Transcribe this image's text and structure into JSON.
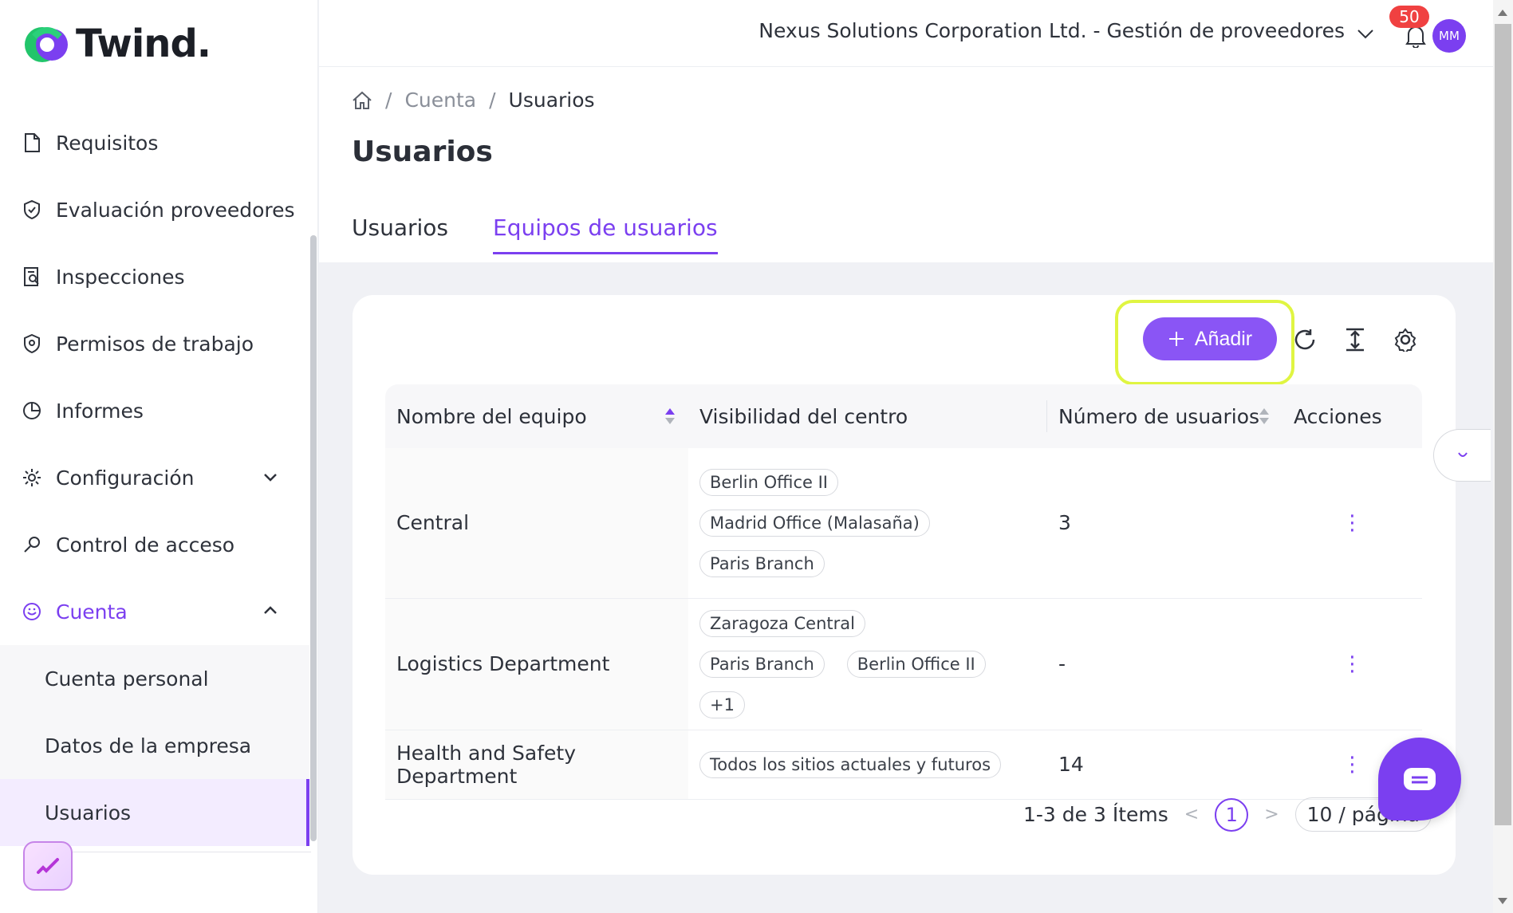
{
  "brand": {
    "name": "Twind."
  },
  "sidebar": {
    "items": [
      {
        "label": "Requisitos"
      },
      {
        "label": "Evaluación proveedores"
      },
      {
        "label": "Inspecciones"
      },
      {
        "label": "Permisos de trabajo"
      },
      {
        "label": "Informes"
      },
      {
        "label": "Configuración"
      },
      {
        "label": "Control de acceso"
      },
      {
        "label": "Cuenta"
      }
    ],
    "sub_items": [
      {
        "label": "Cuenta personal"
      },
      {
        "label": "Datos de la empresa"
      },
      {
        "label": "Usuarios"
      }
    ]
  },
  "topbar": {
    "company": "Nexus Solutions Corporation Ltd. - Gestión de proveedores",
    "notifications": "50",
    "avatar": "MM"
  },
  "breadcrumb": {
    "sep": "/",
    "account": "Cuenta",
    "current": "Usuarios"
  },
  "page": {
    "title": "Usuarios"
  },
  "tabs": [
    {
      "label": "Usuarios"
    },
    {
      "label": "Equipos de usuarios"
    }
  ],
  "toolbar": {
    "add_label": "Añadir"
  },
  "table": {
    "columns": [
      "Nombre del equipo",
      "Visibilidad del centro",
      "Número de usuarios",
      "Acciones"
    ],
    "rows": [
      {
        "name": "Central",
        "tags": [
          "Berlin Office II",
          "Madrid Office (Malasaña)",
          "Paris Branch"
        ],
        "users": "3"
      },
      {
        "name": "Logistics Department",
        "tags": [
          "Zaragoza Central",
          "Paris Branch",
          "Berlin Office II",
          "+1"
        ],
        "users": "-"
      },
      {
        "name": "Health and Safety Department",
        "tags": [
          "Todos los sitios actuales y futuros"
        ],
        "users": "14"
      }
    ]
  },
  "pagination": {
    "summary": "1-3 de 3 Ítems",
    "page": "1",
    "page_size": "10 / página",
    "prev": "<",
    "next": ">"
  },
  "colors": {
    "accent": "#7b3ff0",
    "highlight": "#e0f542",
    "badge": "#f04141"
  }
}
